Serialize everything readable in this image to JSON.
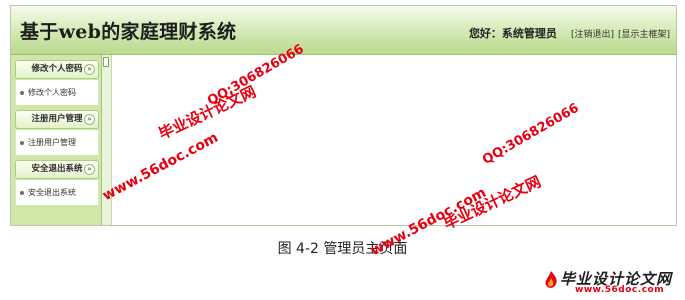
{
  "header": {
    "title": "基于web的家庭理财系统",
    "greeting": "您好：系统管理员",
    "logout_link": "[注销退出]",
    "show_homepage_link": "[显示主框架]"
  },
  "sidebar": {
    "groups": [
      {
        "title": "修改个人密码",
        "items": [
          "修改个人密码"
        ]
      },
      {
        "title": "注册用户管理",
        "items": [
          "注册用户管理"
        ]
      },
      {
        "title": "安全退出系统",
        "items": [
          "安全退出系统"
        ]
      }
    ],
    "collapse_glyph": "»"
  },
  "caption": "图 4-2 管理员主页面",
  "watermarks": {
    "brand": "毕业设计论文网",
    "site": "www.56doc.com",
    "qq": "QQ:306826066"
  },
  "logo": {
    "text": "毕业设计论文网",
    "url": "www.56doc.com"
  },
  "colors": {
    "header_gradient_top": "#f6fbef",
    "header_gradient_bottom": "#bcd98f",
    "sidebar_bg": "#cfe7a9",
    "watermark_red": "#e60012"
  }
}
